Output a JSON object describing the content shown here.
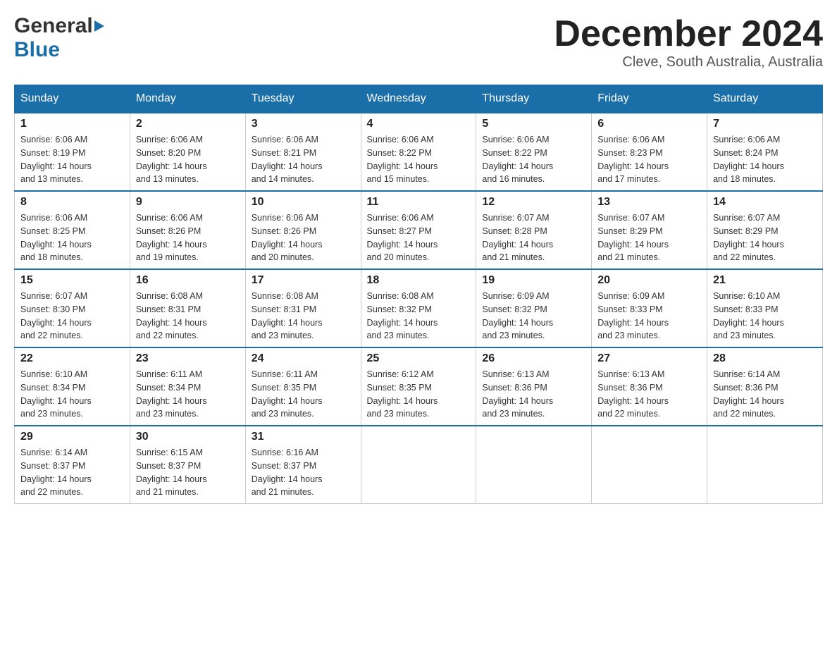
{
  "logo": {
    "general": "General",
    "blue": "Blue"
  },
  "title": {
    "month": "December 2024",
    "location": "Cleve, South Australia, Australia"
  },
  "headers": [
    "Sunday",
    "Monday",
    "Tuesday",
    "Wednesday",
    "Thursday",
    "Friday",
    "Saturday"
  ],
  "weeks": [
    [
      {
        "day": "1",
        "sunrise": "6:06 AM",
        "sunset": "8:19 PM",
        "daylight": "14 hours and 13 minutes."
      },
      {
        "day": "2",
        "sunrise": "6:06 AM",
        "sunset": "8:20 PM",
        "daylight": "14 hours and 13 minutes."
      },
      {
        "day": "3",
        "sunrise": "6:06 AM",
        "sunset": "8:21 PM",
        "daylight": "14 hours and 14 minutes."
      },
      {
        "day": "4",
        "sunrise": "6:06 AM",
        "sunset": "8:22 PM",
        "daylight": "14 hours and 15 minutes."
      },
      {
        "day": "5",
        "sunrise": "6:06 AM",
        "sunset": "8:22 PM",
        "daylight": "14 hours and 16 minutes."
      },
      {
        "day": "6",
        "sunrise": "6:06 AM",
        "sunset": "8:23 PM",
        "daylight": "14 hours and 17 minutes."
      },
      {
        "day": "7",
        "sunrise": "6:06 AM",
        "sunset": "8:24 PM",
        "daylight": "14 hours and 18 minutes."
      }
    ],
    [
      {
        "day": "8",
        "sunrise": "6:06 AM",
        "sunset": "8:25 PM",
        "daylight": "14 hours and 18 minutes."
      },
      {
        "day": "9",
        "sunrise": "6:06 AM",
        "sunset": "8:26 PM",
        "daylight": "14 hours and 19 minutes."
      },
      {
        "day": "10",
        "sunrise": "6:06 AM",
        "sunset": "8:26 PM",
        "daylight": "14 hours and 20 minutes."
      },
      {
        "day": "11",
        "sunrise": "6:06 AM",
        "sunset": "8:27 PM",
        "daylight": "14 hours and 20 minutes."
      },
      {
        "day": "12",
        "sunrise": "6:07 AM",
        "sunset": "8:28 PM",
        "daylight": "14 hours and 21 minutes."
      },
      {
        "day": "13",
        "sunrise": "6:07 AM",
        "sunset": "8:29 PM",
        "daylight": "14 hours and 21 minutes."
      },
      {
        "day": "14",
        "sunrise": "6:07 AM",
        "sunset": "8:29 PM",
        "daylight": "14 hours and 22 minutes."
      }
    ],
    [
      {
        "day": "15",
        "sunrise": "6:07 AM",
        "sunset": "8:30 PM",
        "daylight": "14 hours and 22 minutes."
      },
      {
        "day": "16",
        "sunrise": "6:08 AM",
        "sunset": "8:31 PM",
        "daylight": "14 hours and 22 minutes."
      },
      {
        "day": "17",
        "sunrise": "6:08 AM",
        "sunset": "8:31 PM",
        "daylight": "14 hours and 23 minutes."
      },
      {
        "day": "18",
        "sunrise": "6:08 AM",
        "sunset": "8:32 PM",
        "daylight": "14 hours and 23 minutes."
      },
      {
        "day": "19",
        "sunrise": "6:09 AM",
        "sunset": "8:32 PM",
        "daylight": "14 hours and 23 minutes."
      },
      {
        "day": "20",
        "sunrise": "6:09 AM",
        "sunset": "8:33 PM",
        "daylight": "14 hours and 23 minutes."
      },
      {
        "day": "21",
        "sunrise": "6:10 AM",
        "sunset": "8:33 PM",
        "daylight": "14 hours and 23 minutes."
      }
    ],
    [
      {
        "day": "22",
        "sunrise": "6:10 AM",
        "sunset": "8:34 PM",
        "daylight": "14 hours and 23 minutes."
      },
      {
        "day": "23",
        "sunrise": "6:11 AM",
        "sunset": "8:34 PM",
        "daylight": "14 hours and 23 minutes."
      },
      {
        "day": "24",
        "sunrise": "6:11 AM",
        "sunset": "8:35 PM",
        "daylight": "14 hours and 23 minutes."
      },
      {
        "day": "25",
        "sunrise": "6:12 AM",
        "sunset": "8:35 PM",
        "daylight": "14 hours and 23 minutes."
      },
      {
        "day": "26",
        "sunrise": "6:13 AM",
        "sunset": "8:36 PM",
        "daylight": "14 hours and 23 minutes."
      },
      {
        "day": "27",
        "sunrise": "6:13 AM",
        "sunset": "8:36 PM",
        "daylight": "14 hours and 22 minutes."
      },
      {
        "day": "28",
        "sunrise": "6:14 AM",
        "sunset": "8:36 PM",
        "daylight": "14 hours and 22 minutes."
      }
    ],
    [
      {
        "day": "29",
        "sunrise": "6:14 AM",
        "sunset": "8:37 PM",
        "daylight": "14 hours and 22 minutes."
      },
      {
        "day": "30",
        "sunrise": "6:15 AM",
        "sunset": "8:37 PM",
        "daylight": "14 hours and 21 minutes."
      },
      {
        "day": "31",
        "sunrise": "6:16 AM",
        "sunset": "8:37 PM",
        "daylight": "14 hours and 21 minutes."
      },
      null,
      null,
      null,
      null
    ]
  ],
  "labels": {
    "sunrise": "Sunrise:",
    "sunset": "Sunset:",
    "daylight": "Daylight:"
  }
}
